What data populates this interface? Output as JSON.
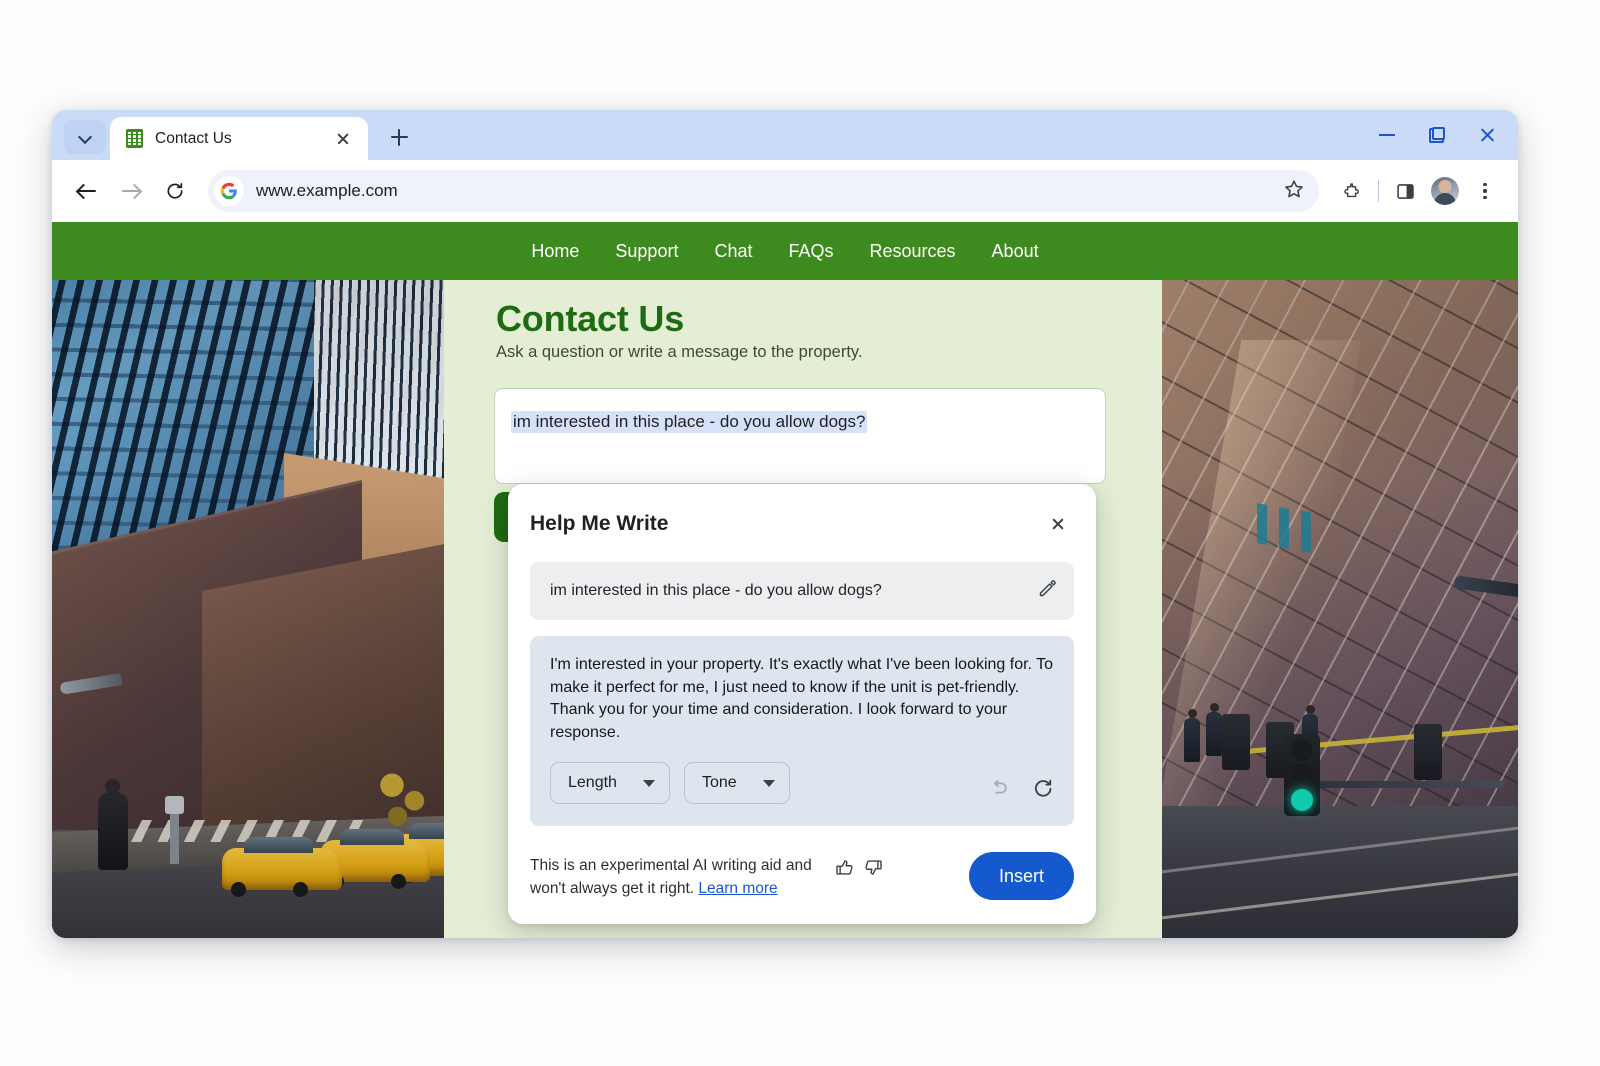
{
  "browser": {
    "tab": {
      "title": "Contact Us",
      "favicon": "green-grid-favicon",
      "close": "close-icon"
    },
    "tab_search": "tab-search-chevron",
    "new_tab": "new-tab-plus",
    "window_controls": {
      "minimize": "minimize",
      "restore": "restore",
      "close": "close"
    },
    "toolbar": {
      "back": "back-arrow",
      "forward": "forward-arrow",
      "reload": "reload-icon",
      "url": "www.example.com",
      "site_icon": "google-g-icon",
      "bookmark": "star-icon",
      "extensions": "puzzle-icon",
      "side_panel": "side-panel-icon",
      "profile": "avatar",
      "menu": "kebab-menu-icon"
    }
  },
  "site": {
    "nav": [
      "Home",
      "Support",
      "Chat",
      "FAQs",
      "Resources",
      "About"
    ],
    "nav_color": "#3d8b1e",
    "background": "#e4eed4",
    "title": "Contact Us",
    "subtitle": "Ask a question or write a message to the property.",
    "message_box": {
      "value": "im interested in this place - do you allow dogs?",
      "selected": true,
      "selection_color": "#d7e1f7"
    },
    "submit_button": {
      "label": "",
      "color": "#1e6b0f"
    },
    "photo_left": "city-buildings-with-yellow-taxis",
    "photo_right": "glass-office-facade-with-traffic-light"
  },
  "dialog": {
    "title": "Help Me Write",
    "close": "close-icon",
    "prompt": {
      "text": "im interested in this place - do you allow dogs?",
      "edit_icon": "pencil-icon"
    },
    "result": {
      "text": "I'm interested in your property. It's exactly what I've been looking for. To make it perfect for me, I just need to know if the unit is pet-friendly. Thank you for your time and consideration. I look forward to your response."
    },
    "controls": {
      "length": "Length",
      "tone": "Tone",
      "undo": "undo-icon",
      "refresh": "refresh-icon"
    },
    "footer": {
      "note_line1": "This is an experimental AI writing aid and",
      "note_line2": "won't always get it right. ",
      "learn_more": "Learn more",
      "thumb_up": "thumb-up-icon",
      "thumb_down": "thumb-down-icon",
      "insert": "Insert",
      "insert_color": "#1559cf"
    }
  }
}
